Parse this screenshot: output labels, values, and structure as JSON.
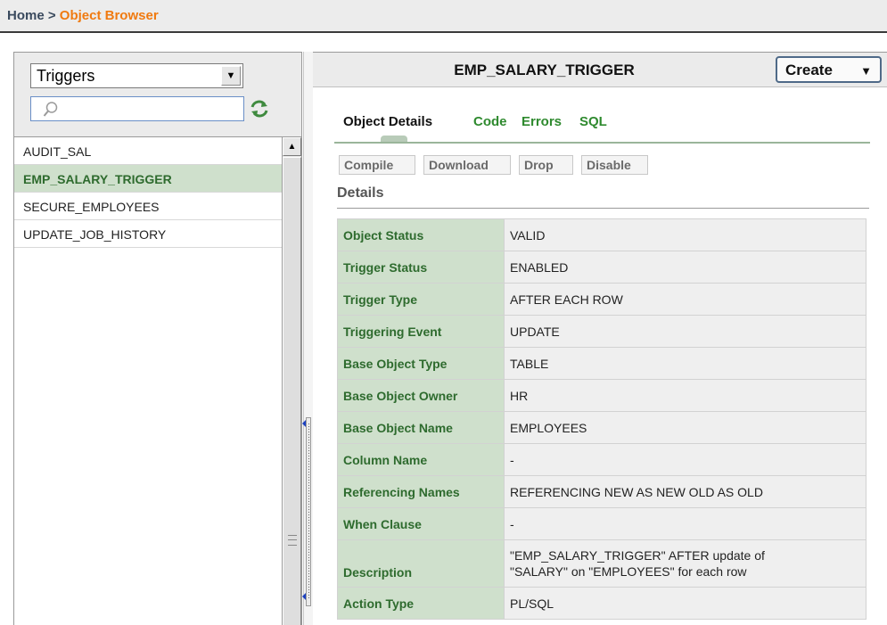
{
  "breadcrumb": {
    "home": "Home",
    "separator": ">",
    "current": "Object Browser"
  },
  "left": {
    "type_select": {
      "value": "Triggers"
    },
    "search": {
      "value": ""
    },
    "items": [
      {
        "label": "AUDIT_SAL",
        "selected": false
      },
      {
        "label": "EMP_SALARY_TRIGGER",
        "selected": true
      },
      {
        "label": "SECURE_EMPLOYEES",
        "selected": false
      },
      {
        "label": "UPDATE_JOB_HISTORY",
        "selected": false
      }
    ]
  },
  "object": {
    "title": "EMP_SALARY_TRIGGER",
    "create_label": "Create"
  },
  "tabs": [
    {
      "label": "Object Details",
      "active": true
    },
    {
      "label": "Code",
      "active": false
    },
    {
      "label": "Errors",
      "active": false
    },
    {
      "label": "SQL",
      "active": false
    }
  ],
  "actions": {
    "compile": "Compile",
    "download": "Download",
    "drop": "Drop",
    "disable": "Disable"
  },
  "details": {
    "title": "Details",
    "rows": [
      {
        "label": "Object Status",
        "value": "VALID"
      },
      {
        "label": "Trigger Status",
        "value": "ENABLED"
      },
      {
        "label": "Trigger Type",
        "value": "AFTER EACH ROW"
      },
      {
        "label": "Triggering Event",
        "value": "UPDATE"
      },
      {
        "label": "Base Object Type",
        "value": "TABLE"
      },
      {
        "label": "Base Object Owner",
        "value": "HR"
      },
      {
        "label": "Base Object Name",
        "value": "EMPLOYEES"
      },
      {
        "label": "Column Name",
        "value": "-"
      },
      {
        "label": "Referencing Names",
        "value": "REFERENCING NEW AS NEW OLD AS OLD"
      },
      {
        "label": "When Clause",
        "value": "-"
      },
      {
        "label": "Description",
        "value_line1": "\"EMP_SALARY_TRIGGER\" AFTER update of",
        "value_line2": "\"SALARY\" on \"EMPLOYEES\" for each row"
      },
      {
        "label": "Action Type",
        "value": "PL/SQL"
      }
    ]
  },
  "icons": {
    "dropdown": "chevron-down-icon",
    "search": "magnifier-icon",
    "refresh": "refresh-icon",
    "create_arrow": "triangle-down-icon"
  },
  "colors": {
    "breadcrumb_current": "#f07a10",
    "tab_link": "#2f8a2f",
    "label_bg": "#cfe0cc",
    "label_text": "#2e6b2e",
    "value_bg": "#efefef"
  }
}
